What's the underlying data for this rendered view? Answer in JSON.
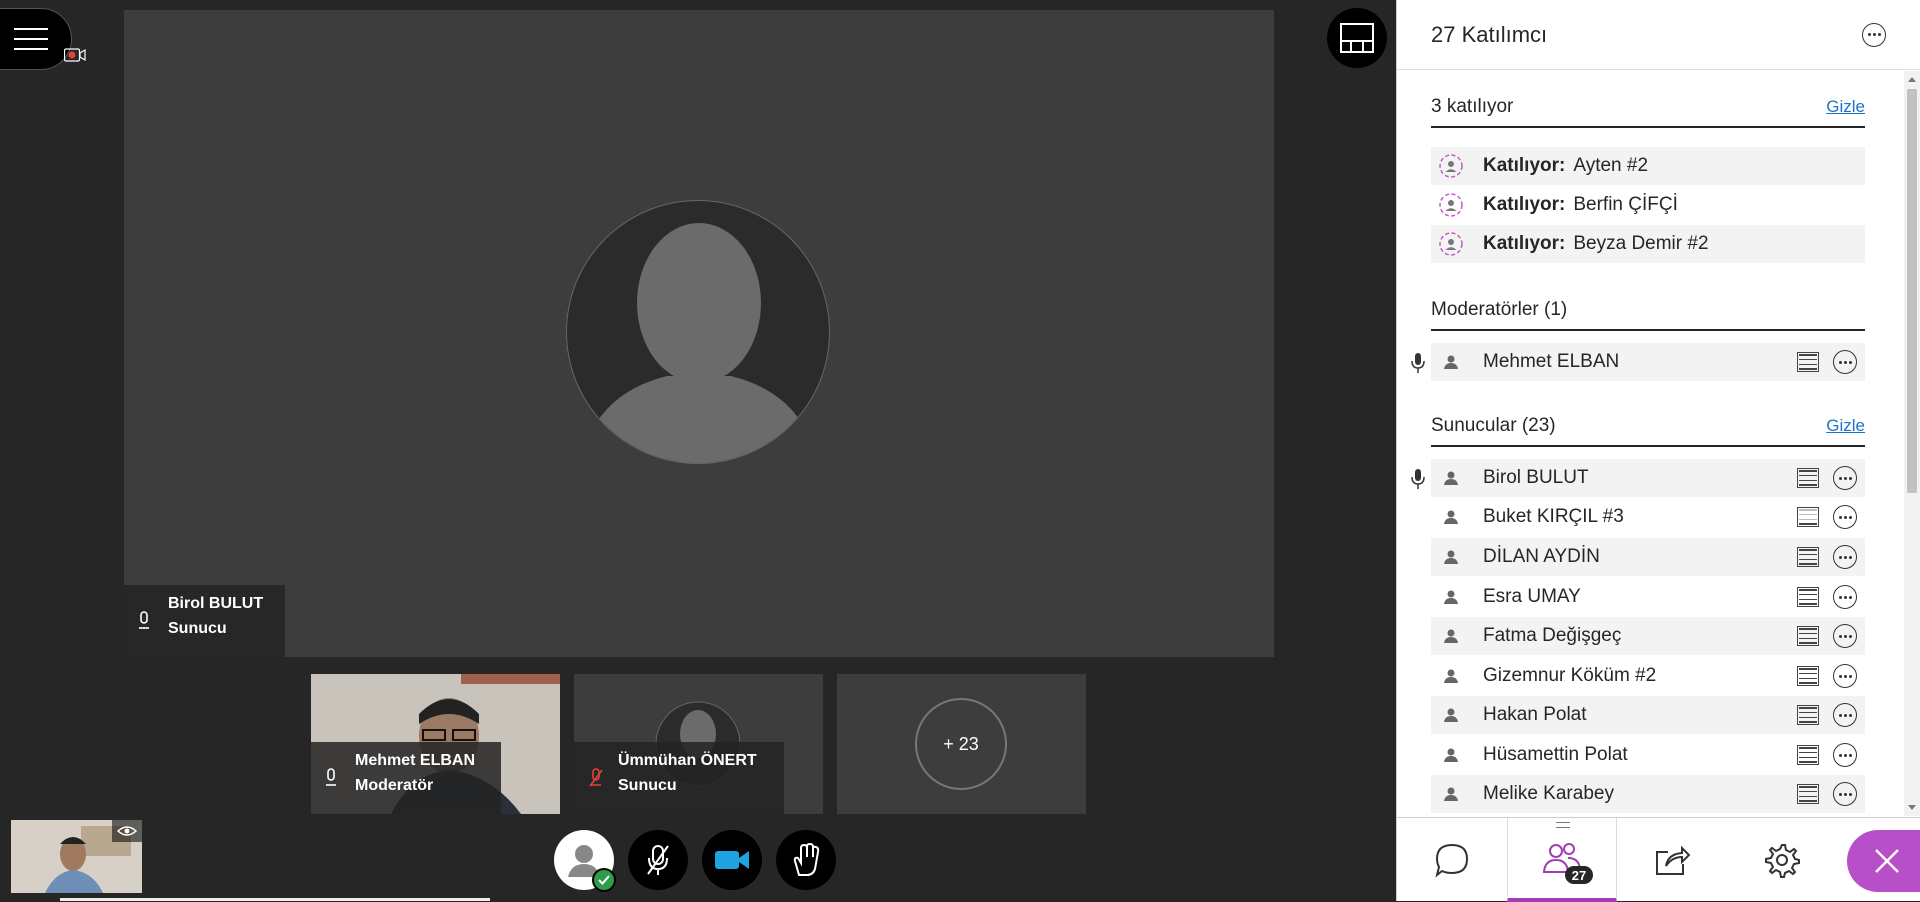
{
  "stage": {
    "main_speaker": {
      "name": "Birol BULUT",
      "role": "Sunucu"
    },
    "thumbnails": [
      {
        "name": "Mehmet ELBAN",
        "role": "Moderatör"
      },
      {
        "name": "Ümmühan ÖNERT",
        "role": "Sunucu"
      }
    ],
    "more_count": "+ 23"
  },
  "panel": {
    "title": "27 Katılımcı",
    "joining": {
      "heading": "3 katılıyor",
      "hide_label": "Gizle",
      "items": [
        {
          "label": "Katılıyor:",
          "name": "Ayten #2"
        },
        {
          "label": "Katılıyor:",
          "name": "Berfin ÇİFÇİ"
        },
        {
          "label": "Katılıyor:",
          "name": "Beyza Demir #2"
        }
      ]
    },
    "moderators": {
      "heading": "Moderatörler (1)",
      "items": [
        {
          "name": "Mehmet ELBAN"
        }
      ]
    },
    "presenters": {
      "heading": "Sunucular (23)",
      "hide_label": "Gizle",
      "items": [
        {
          "name": "Birol BULUT"
        },
        {
          "name": "Buket KIRÇIL #3"
        },
        {
          "name": "DİLAN AYDİN"
        },
        {
          "name": "Esra UMAY"
        },
        {
          "name": "Fatma Değişgeç"
        },
        {
          "name": "Gizemnur Köküm #2"
        },
        {
          "name": "Hakan Polat"
        },
        {
          "name": "Hüsamettin Polat"
        },
        {
          "name": "Melike Karabey"
        }
      ]
    },
    "tabs": {
      "participants_badge": "27"
    }
  },
  "icons": {
    "menu": "hamburger-icon",
    "record": "recording-icon",
    "layout": "layout-icon",
    "mic": "mic-icon",
    "mic_muted": "mic-muted-icon",
    "camera": "camera-icon",
    "hand": "raise-hand-icon",
    "chat": "chat-icon",
    "participants": "participants-icon",
    "share": "share-icon",
    "settings": "gear-icon",
    "close": "close-icon"
  },
  "colors": {
    "accent": "#a23db4",
    "close": "#b64fc8",
    "link": "#1a73c8",
    "camera_blue": "#1fa2e0",
    "mic_muted": "#e0443c",
    "joining": "#c35cc9"
  }
}
